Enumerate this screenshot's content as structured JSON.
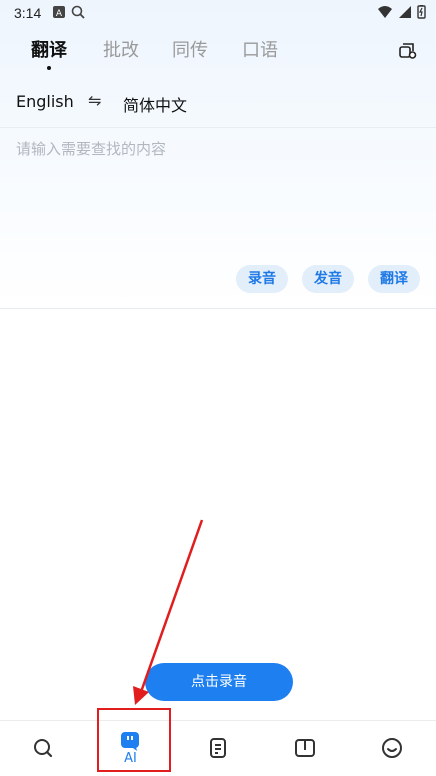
{
  "status_bar": {
    "time": "3:14"
  },
  "header": {
    "tabs": [
      {
        "label": "翻译",
        "active": true
      },
      {
        "label": "批改",
        "active": false
      },
      {
        "label": "同传",
        "active": false
      },
      {
        "label": "口语",
        "active": false
      }
    ],
    "right_icon": "device-history-icon"
  },
  "languages": {
    "source": "English",
    "swap_symbol": "⇋",
    "target": "简体中文"
  },
  "input": {
    "placeholder": "请输入需要查找的内容",
    "value": ""
  },
  "actions": {
    "record": "录音",
    "pronounce": "发音",
    "translate": "翻译"
  },
  "record_button": {
    "label": "点击录音"
  },
  "bottom_nav": {
    "items": [
      {
        "icon": "search-icon",
        "label": ""
      },
      {
        "icon": "ai-robot-icon",
        "label": "AI",
        "active": true
      },
      {
        "icon": "document-icon",
        "label": ""
      },
      {
        "icon": "book-icon",
        "label": ""
      },
      {
        "icon": "smile-icon",
        "label": ""
      }
    ]
  },
  "colors": {
    "accent": "#1e7ff0",
    "pill_bg": "#e3eefb",
    "annotation": "#e11d1d"
  }
}
